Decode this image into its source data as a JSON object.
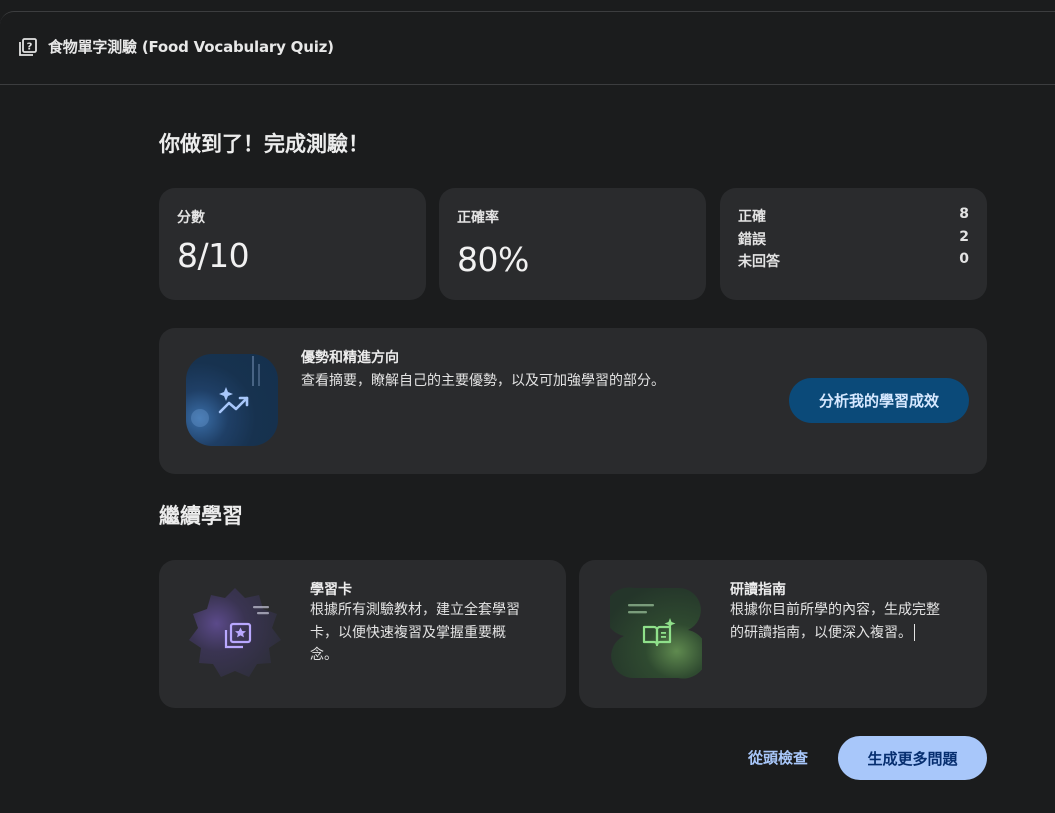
{
  "header": {
    "title": "食物單字測驗 (Food Vocabulary Quiz)",
    "icon": "quiz-icon"
  },
  "completion": {
    "heading": "你做到了！完成測驗！"
  },
  "stats": {
    "score_label": "分數",
    "score_value": "8/10",
    "accuracy_label": "正確率",
    "accuracy_value": "80%",
    "breakdown": [
      {
        "label": "正確",
        "value": "8"
      },
      {
        "label": "錯誤",
        "value": "2"
      },
      {
        "label": "未回答",
        "value": "0"
      }
    ]
  },
  "insights": {
    "title": "優勢和精進方向",
    "description": "查看摘要，瞭解自己的主要優勢，以及可加強學習的部分。",
    "button_label": "分析我的學習成效",
    "icon": "sparkle-trend-icon"
  },
  "continue_learning": {
    "heading": "繼續學習",
    "flashcards": {
      "title": "學習卡",
      "description_lines": [
        "根據所有測驗教材，建立全套學習",
        "卡，以便快速複習及掌握重要概",
        "念。"
      ],
      "icon": "flashcards-icon"
    },
    "study_guide": {
      "title": "研讀指南",
      "description_lines": [
        "根據你目前所學的內容，生成完整",
        "的研讀指南，以便深入複習。"
      ],
      "icon": "study-guide-icon"
    }
  },
  "footer": {
    "review_label": "從頭檢查",
    "generate_label": "生成更多問題"
  },
  "colors": {
    "background": "#1b1c1d",
    "card": "#2a2b2d",
    "accent_blue": "#a8c7fa",
    "dark_button": "#0b4a79"
  }
}
